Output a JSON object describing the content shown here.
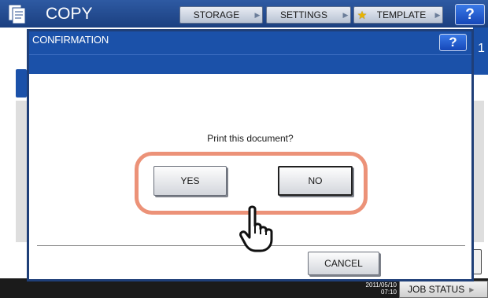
{
  "header": {
    "title": "COPY",
    "buttons": [
      {
        "label": "STORAGE",
        "icon": "arrow-right-icon"
      },
      {
        "label": "SETTINGS",
        "icon": "arrow-right-icon"
      },
      {
        "label": "TEMPLATE",
        "icon": "star-icon"
      }
    ],
    "help": "?"
  },
  "background": {
    "page_number": "1"
  },
  "dialog": {
    "title": "CONFIRMATION",
    "help": "?",
    "message": "Print this document?",
    "yes_label": "YES",
    "no_label": "NO",
    "cancel_label": "CANCEL"
  },
  "status_bar": {
    "date": "2011/05/10",
    "time": "07:10",
    "job_status_label": "JOB STATUS"
  },
  "colors": {
    "header_blue": "#1b51a9",
    "highlight": "#ec9278",
    "help_blue": "#2563d6"
  }
}
